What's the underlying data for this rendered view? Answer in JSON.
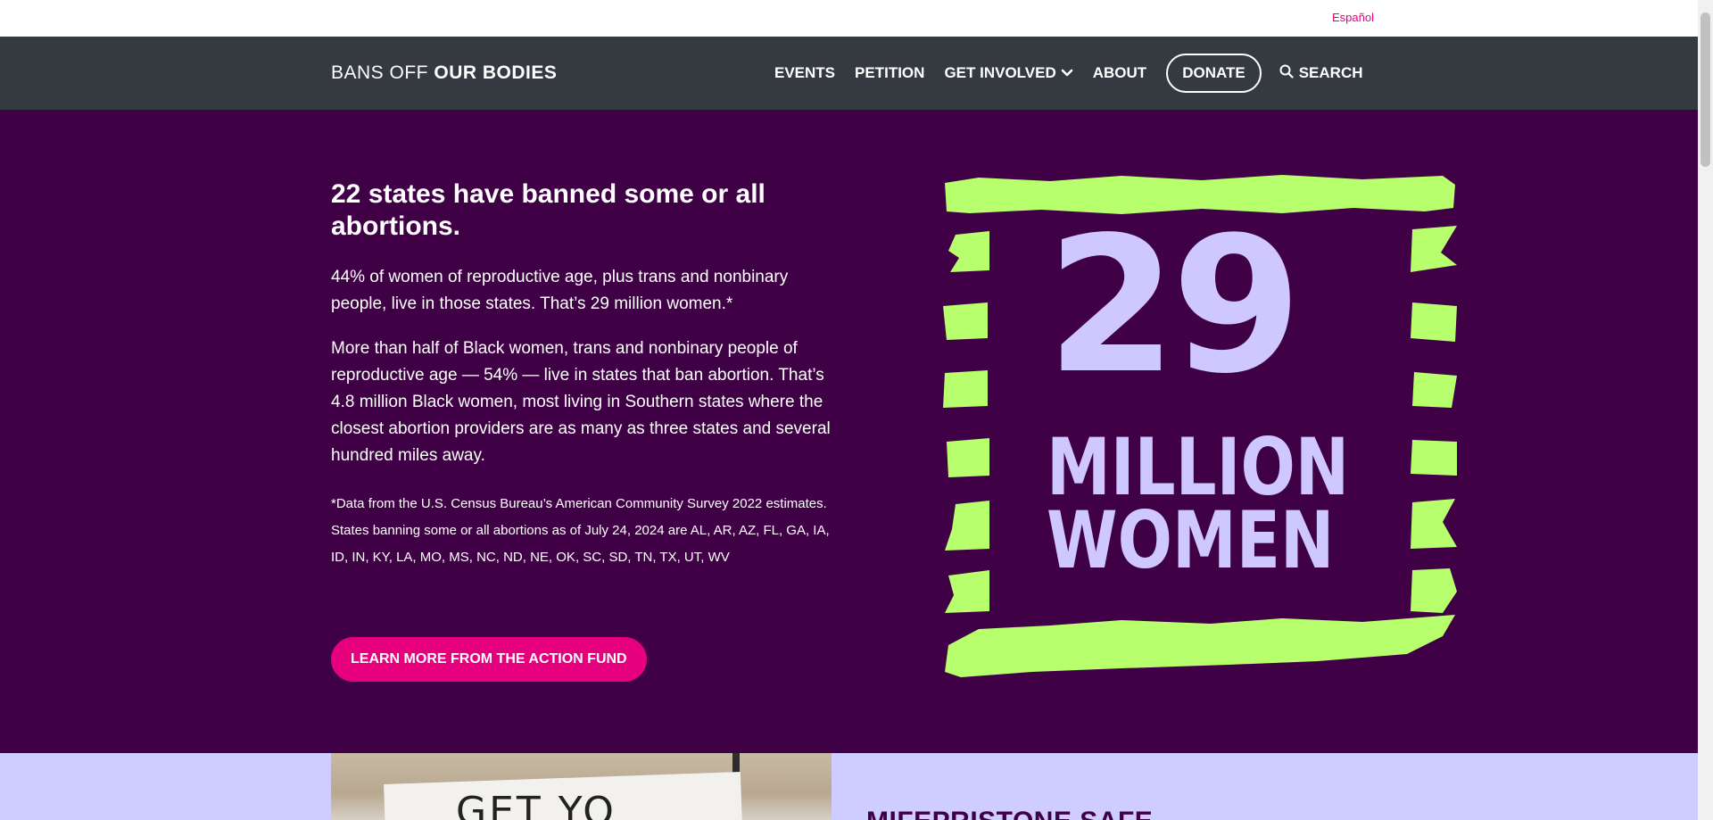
{
  "topbar": {
    "language_link": "Español"
  },
  "nav": {
    "brand_light": "BANS OFF",
    "brand_bold": "OUR BODIES",
    "items": [
      {
        "label": "EVENTS"
      },
      {
        "label": "PETITION"
      },
      {
        "label": "GET INVOLVED"
      },
      {
        "label": "ABOUT"
      }
    ],
    "donate": "DONATE",
    "search": "SEARCH"
  },
  "hero": {
    "headline": "22 states have banned some or all abortions.",
    "paragraph1": "44% of women of reproductive age, plus trans and nonbinary people, live in those states. That’s 29 million women.*",
    "paragraph2": "More than half of Black women, trans and nonbinary people of reproductive age — 54% — live in states that ban abortion. That’s 4.8 million Black women, most living in Southern states where the closest abortion providers are as many as three states and several hundred miles away.",
    "footnote": "*Data from the U.S. Census Bureau’s American Community Survey 2022 estimates. States banning some or all abortions as of July 24, 2024 are AL, AR, AZ, FL, GA, IA, ID, IN, KY, LA, MO, MS, NC, ND, NE, OK, SC, SD, TN, TX, UT, WV",
    "cta": "LEARN MORE FROM THE ACTION FUND",
    "graphic": {
      "number": "29",
      "line1": "MILLION",
      "line2": "WOMEN"
    }
  },
  "section2": {
    "sign_text": "GET YO",
    "title": "MIFEPRISTONE SAFE"
  },
  "colors": {
    "nav_bg": "#343a40",
    "hero_bg": "#400046",
    "accent_pink": "#e6007e",
    "lime": "#b8ff6e",
    "lavender": "#cfc7ff",
    "section2_bg": "#cfccff"
  }
}
